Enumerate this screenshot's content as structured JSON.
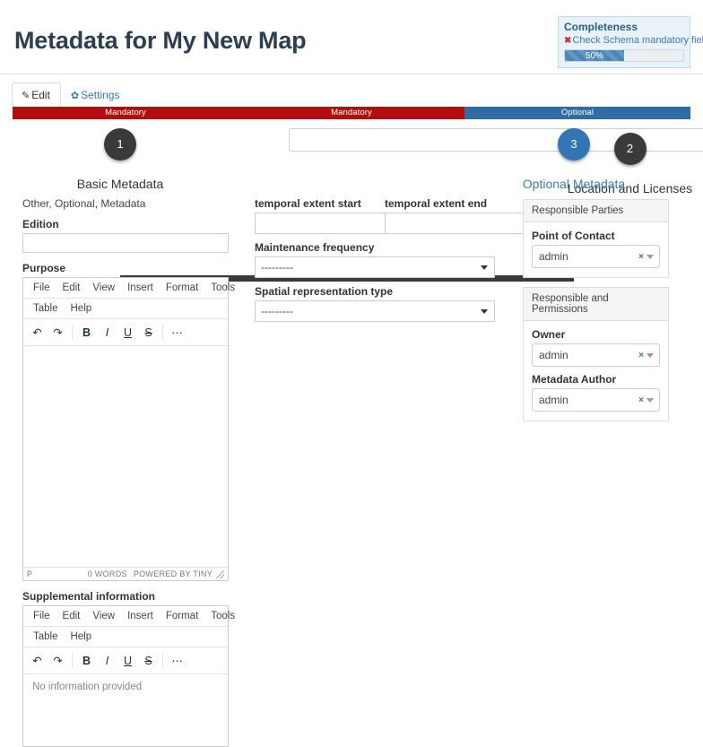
{
  "page_title": "Metadata for My New Map",
  "completeness": {
    "title": "Completeness",
    "check_link": "Check Schema mandatory fields",
    "xmark": "✖",
    "percent_label": "50%",
    "percent_value": 50,
    "bar_color": "#4a86b8"
  },
  "tabs": [
    {
      "label": "Edit",
      "icon": "pencil-icon",
      "glyph": "✎",
      "active": true
    },
    {
      "label": "Settings",
      "icon": "gear-icon",
      "glyph": "✿",
      "active": false
    }
  ],
  "banner": {
    "segments": [
      {
        "label": "Mandatory",
        "color": "#b30d0d"
      },
      {
        "label": "Mandatory",
        "color": "#b30d0d"
      },
      {
        "label": "Optional",
        "color": "#2f6ca5"
      }
    ]
  },
  "wizard": {
    "steps": [
      {
        "number": "1",
        "label": "Basic Metadata",
        "active": false
      },
      {
        "number": "2",
        "label": "Location and Licenses",
        "active": false
      },
      {
        "number": "3",
        "label": "Optional Metadata",
        "active": true
      }
    ],
    "active_color": "#3275b3",
    "done_color": "#3a3a3a"
  },
  "left_column": {
    "section_header": "Other, Optional, Metadata",
    "edition": {
      "label": "Edition",
      "value": "",
      "placeholder": ""
    },
    "purpose": {
      "label": "Purpose",
      "menus_row1": [
        "File",
        "Edit",
        "View",
        "Insert",
        "Format",
        "Tools"
      ],
      "menus_row2": [
        "Table",
        "Help"
      ],
      "toolbar": [
        {
          "name": "undo-icon",
          "glyph": "↶"
        },
        {
          "name": "redo-icon",
          "glyph": "↷"
        },
        {
          "name": "bold-icon",
          "glyph": "B"
        },
        {
          "name": "italic-icon",
          "glyph": "I"
        },
        {
          "name": "underline-icon",
          "glyph": "U"
        },
        {
          "name": "strikethrough-icon",
          "glyph": "S"
        },
        {
          "name": "more-icon",
          "glyph": "⋯"
        }
      ],
      "content": "",
      "status_path": "P",
      "status_words": "0 WORDS",
      "status_brand": "POWERED BY TINY"
    },
    "supplemental": {
      "label": "Supplemental information",
      "menus_row1": [
        "File",
        "Edit",
        "View",
        "Insert",
        "Format",
        "Tools"
      ],
      "menus_row2": [
        "Table",
        "Help"
      ],
      "toolbar": [
        {
          "name": "undo-icon",
          "glyph": "↶"
        },
        {
          "name": "redo-icon",
          "glyph": "↷"
        },
        {
          "name": "bold-icon",
          "glyph": "B"
        },
        {
          "name": "italic-icon",
          "glyph": "I"
        },
        {
          "name": "underline-icon",
          "glyph": "U"
        },
        {
          "name": "strikethrough-icon",
          "glyph": "S"
        },
        {
          "name": "more-icon",
          "glyph": "⋯"
        }
      ],
      "content": "No information provided"
    }
  },
  "middle_column": {
    "temporal_start": {
      "label": "temporal extent start",
      "value": "",
      "icon": "calendar-icon"
    },
    "temporal_end": {
      "label": "temporal extent end",
      "value": "",
      "icon": "calendar-icon"
    },
    "maintenance_frequency": {
      "label": "Maintenance frequency",
      "value": "---------"
    },
    "spatial_representation_type": {
      "label": "Spatial representation type",
      "value": "---------"
    }
  },
  "right_column": {
    "panels": [
      {
        "header": "Responsible Parties",
        "fields": [
          {
            "label": "Point of Contact",
            "value": "admin",
            "clear": "×"
          }
        ]
      },
      {
        "header": "Responsible and Permissions",
        "fields": [
          {
            "label": "Owner",
            "value": "admin",
            "clear": "×"
          },
          {
            "label": "Metadata Author",
            "value": "admin",
            "clear": "×"
          }
        ]
      }
    ]
  }
}
